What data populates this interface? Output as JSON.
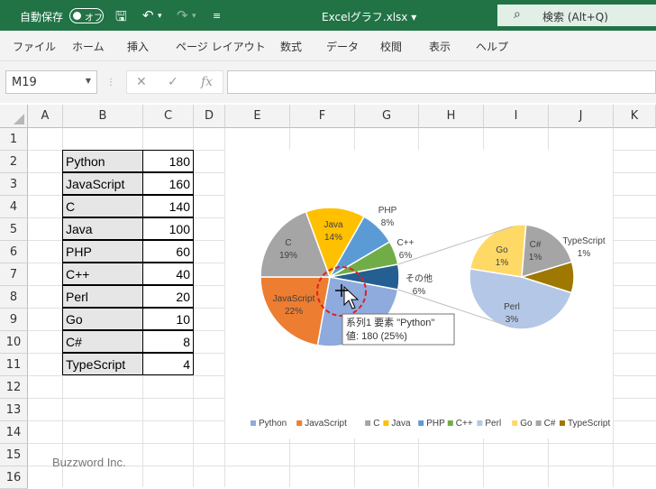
{
  "titlebar": {
    "autosave_label": "自動保存",
    "toggle_text": "オフ",
    "filename": "Excelグラフ.xlsx ▾",
    "search_label": "検索 (Alt+Q)"
  },
  "ribbon": {
    "tabs": [
      "ファイル",
      "ホーム",
      "挿入",
      "ページ レイアウト",
      "数式",
      "データ",
      "校閲",
      "表示",
      "ヘルプ"
    ]
  },
  "formula_bar": {
    "name_box": "M19",
    "formula": ""
  },
  "columns": [
    "A",
    "B",
    "C",
    "D",
    "E",
    "F",
    "G",
    "H",
    "I",
    "J",
    "K"
  ],
  "rows": [
    "1",
    "2",
    "3",
    "4",
    "5",
    "6",
    "7",
    "8",
    "9",
    "10",
    "11",
    "12",
    "13",
    "14",
    "15",
    "16"
  ],
  "table": [
    {
      "name": "Python",
      "value": "180"
    },
    {
      "name": "JavaScript",
      "value": "160"
    },
    {
      "name": "C",
      "value": "140"
    },
    {
      "name": "Java",
      "value": "100"
    },
    {
      "name": "PHP",
      "value": "60"
    },
    {
      "name": "C++",
      "value": "40"
    },
    {
      "name": "Perl",
      "value": "20"
    },
    {
      "name": "Go",
      "value": "10"
    },
    {
      "name": "C#",
      "value": "8"
    },
    {
      "name": "TypeScript",
      "value": "4"
    }
  ],
  "chart_data": {
    "type": "pie",
    "subtype": "pie-of-pie",
    "main_slices": [
      {
        "label": "Python",
        "value": 180,
        "pct": "25%",
        "color": "#8faadc"
      },
      {
        "label": "JavaScript",
        "value": 160,
        "pct": "22%",
        "color": "#ed7d31"
      },
      {
        "label": "C",
        "value": 140,
        "pct": "19%",
        "color": "#a5a5a5"
      },
      {
        "label": "Java",
        "value": 100,
        "pct": "14%",
        "color": "#ffc000"
      },
      {
        "label": "PHP",
        "value": 60,
        "pct": "8%",
        "color": "#5b9bd5"
      },
      {
        "label": "C++",
        "value": 40,
        "pct": "6%",
        "color": "#70ad47"
      },
      {
        "label": "その他",
        "value": 42,
        "pct": "6%",
        "color": "#255e91"
      }
    ],
    "secondary_slices": [
      {
        "label": "Perl",
        "value": 20,
        "pct": "3%",
        "color": "#b4c7e7"
      },
      {
        "label": "Go",
        "value": 10,
        "pct": "1%",
        "color": "#ffd966"
      },
      {
        "label": "C#",
        "value": 8,
        "pct": "1%",
        "color": "#a5a5a5"
      },
      {
        "label": "TypeScript",
        "value": 4,
        "pct": "1%",
        "color": "#9e7800"
      }
    ],
    "legend": [
      "Python",
      "JavaScript",
      "C",
      "Java",
      "PHP",
      "C++",
      "Perl",
      "Go",
      "C#",
      "TypeScript"
    ],
    "legend_colors": [
      "#8faadc",
      "#ed7d31",
      "#a5a5a5",
      "#ffc000",
      "#5b9bd5",
      "#70ad47",
      "#b4c7e7",
      "#ffd966",
      "#a5a5a5",
      "#9e7800"
    ],
    "legend_position": "bottom",
    "tooltip": {
      "line1": "系列1 要素 \"Python\"",
      "line2": "値: 180 (25%)"
    }
  },
  "watermark": "Buzzword Inc."
}
